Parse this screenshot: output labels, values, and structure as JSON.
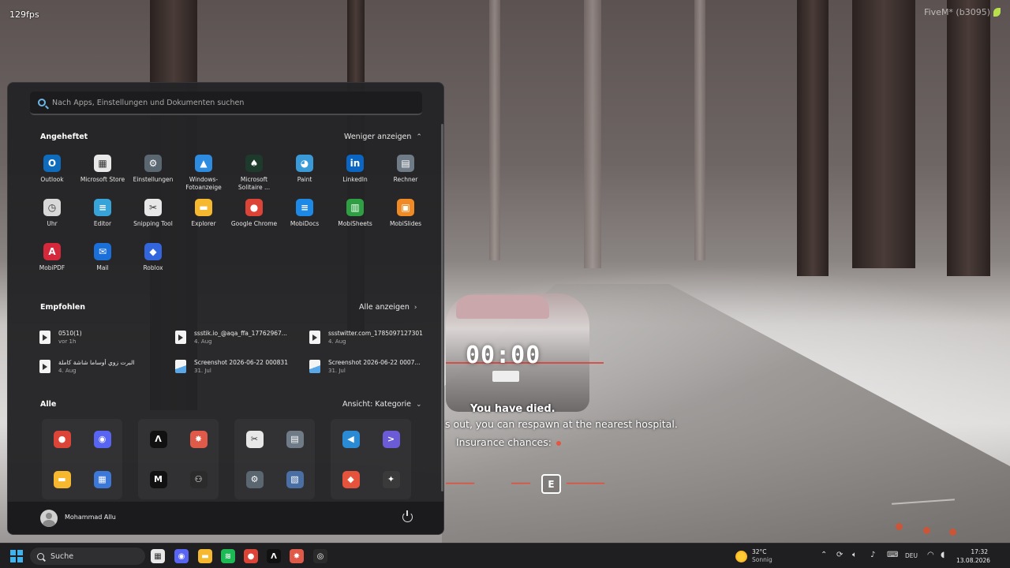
{
  "overlay": {
    "fps": "129fps",
    "build": "FiveM* (b3095)"
  },
  "game_hud": {
    "timer": "00:00",
    "died": "You have died.",
    "respawn": "s out, you can respawn at the nearest hospital.",
    "insurance": "Insurance chances:",
    "key": "E"
  },
  "start_menu": {
    "search_placeholder": "Nach Apps, Einstellungen und Dokumenten suchen",
    "pinned_title": "Angeheftet",
    "pinned_action": "Weniger anzeigen",
    "pinned": [
      {
        "label": "Outlook",
        "icon": "outlook-icon",
        "color": "#0f6cbd",
        "glyph": "O"
      },
      {
        "label": "Microsoft Store",
        "icon": "store-icon",
        "color": "#e8e8e8",
        "glyph": "▦"
      },
      {
        "label": "Einstellungen",
        "icon": "gear-icon",
        "color": "#5b6770",
        "glyph": "⚙"
      },
      {
        "label": "Windows-Fotoanzeige",
        "icon": "photos-icon",
        "color": "#2d8be0",
        "glyph": "▲"
      },
      {
        "label": "Microsoft Solitaire ...",
        "icon": "cards-icon",
        "color": "#1d3a2c",
        "glyph": "♠"
      },
      {
        "label": "Paint",
        "icon": "paint-icon",
        "color": "#3a9ad8",
        "glyph": "◕"
      },
      {
        "label": "LinkedIn",
        "icon": "linkedin-icon",
        "color": "#0a66c2",
        "glyph": "in"
      },
      {
        "label": "Rechner",
        "icon": "calculator-icon",
        "color": "#6f7b86",
        "glyph": "▤"
      },
      {
        "label": "Uhr",
        "icon": "clock-icon",
        "color": "#d8d8d8",
        "glyph": "◷"
      },
      {
        "label": "Editor",
        "icon": "notepad-icon",
        "color": "#38a3d8",
        "glyph": "≡"
      },
      {
        "label": "Snipping Tool",
        "icon": "scissors-icon",
        "color": "#e7e7e7",
        "glyph": "✂"
      },
      {
        "label": "Explorer",
        "icon": "folder-icon",
        "color": "#f5b82e",
        "glyph": "▬"
      },
      {
        "label": "Google Chrome",
        "icon": "chrome-icon",
        "color": "#db4437",
        "glyph": "●"
      },
      {
        "label": "MobiDocs",
        "icon": "mobidocs-icon",
        "color": "#1e88e5",
        "glyph": "≡"
      },
      {
        "label": "MobiSheets",
        "icon": "mobisheets-icon",
        "color": "#2ea043",
        "glyph": "▥"
      },
      {
        "label": "MobiSlides",
        "icon": "mobislides-icon",
        "color": "#f08a24",
        "glyph": "▣"
      },
      {
        "label": "MobiPDF",
        "icon": "mobipdf-icon",
        "color": "#d6283b",
        "glyph": "A"
      },
      {
        "label": "Mail",
        "icon": "mail-icon",
        "color": "#1a6fd8",
        "glyph": "✉"
      },
      {
        "label": "Roblox",
        "icon": "roblox-icon",
        "color": "#3366dd",
        "glyph": "◆"
      }
    ],
    "recommended_title": "Empfohlen",
    "recommended_action": "Alle anzeigen",
    "recommended": [
      {
        "name": "0510(1)",
        "meta": "vor 1h",
        "type": "vid"
      },
      {
        "name": "ssstik.io_@aqa_ffa_17762967...",
        "meta": "4. Aug",
        "type": "vid"
      },
      {
        "name": "ssstwitter.com_1785097127301",
        "meta": "4. Aug",
        "type": "vid"
      },
      {
        "name": "البرت زوي أوساما شاشة كاملة",
        "meta": "4. Aug",
        "type": "vid"
      },
      {
        "name": "Screenshot 2026-06-22 000831",
        "meta": "31. Jul",
        "type": "img"
      },
      {
        "name": "Screenshot 2026-06-22 0007...",
        "meta": "31. Jul",
        "type": "img"
      }
    ],
    "all_title": "Alle",
    "all_action": "Ansicht: Kategorie",
    "groups": [
      [
        {
          "icon": "chrome-icon",
          "color": "#db4437",
          "glyph": "●"
        },
        {
          "icon": "discord-icon",
          "color": "#5865f2",
          "glyph": "◉"
        },
        {
          "icon": "folder-icon",
          "color": "#f5b82e",
          "glyph": "▬"
        },
        {
          "icon": "apps-icon",
          "color": "#3b78d8",
          "glyph": "▦"
        }
      ],
      [
        {
          "icon": "alpha-icon",
          "color": "#111111",
          "glyph": "Λ"
        },
        {
          "icon": "spark-icon",
          "color": "#e05a4a",
          "glyph": "✸"
        },
        {
          "icon": "m-logo-icon",
          "color": "#111111",
          "glyph": "M"
        },
        {
          "icon": "gamepad-icon",
          "color": "#2b2b2b",
          "glyph": "⚇"
        }
      ],
      [
        {
          "icon": "scissors-icon",
          "color": "#e7e7e7",
          "glyph": "✂"
        },
        {
          "icon": "calculator-icon",
          "color": "#6f7b86",
          "glyph": "▤"
        },
        {
          "icon": "gear-icon",
          "color": "#5b6770",
          "glyph": "⚙"
        },
        {
          "icon": "tools-icon",
          "color": "#4a6fa5",
          "glyph": "▧"
        }
      ],
      [
        {
          "icon": "vscode-icon",
          "color": "#2a8ad4",
          "glyph": "◀"
        },
        {
          "icon": "terminal-icon",
          "color": "#6b5bd6",
          "glyph": ">"
        },
        {
          "icon": "git-icon",
          "color": "#e5533d",
          "glyph": "◆"
        },
        {
          "icon": "shapes-icon",
          "color": "#3a3a3a",
          "glyph": "✦"
        }
      ]
    ],
    "user": "Mohammad Allu"
  },
  "taskbar": {
    "search_label": "Suche",
    "apps": [
      {
        "icon": "store-icon",
        "color": "#e8e8e8",
        "glyph": "▦"
      },
      {
        "icon": "discord-icon",
        "color": "#5865f2",
        "glyph": "◉"
      },
      {
        "icon": "folder-icon",
        "color": "#f5b82e",
        "glyph": "▬"
      },
      {
        "icon": "spotify-icon",
        "color": "#1db954",
        "glyph": "≋"
      },
      {
        "icon": "chrome-icon",
        "color": "#db4437",
        "glyph": "●"
      },
      {
        "icon": "alpha-icon",
        "color": "#111111",
        "glyph": "Λ"
      },
      {
        "icon": "spark-icon",
        "color": "#e05a4a",
        "glyph": "✸"
      },
      {
        "icon": "fivem-icon",
        "color": "#2b2b2b",
        "glyph": "◎"
      }
    ],
    "weather_temp": "32°C",
    "weather_desc": "Sonnig",
    "lang": "DEU",
    "time": "17:32",
    "date": "13.08.2026"
  }
}
